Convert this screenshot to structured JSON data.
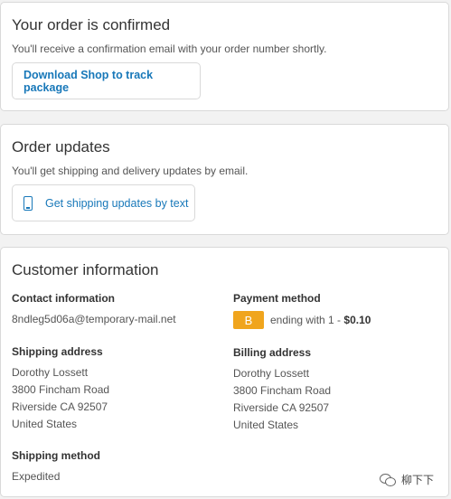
{
  "confirmation": {
    "title": "Your order is confirmed",
    "subtitle": "You'll receive a confirmation email with your order number shortly.",
    "button_label": "Download Shop to track package"
  },
  "updates": {
    "title": "Order updates",
    "subtitle": "You'll get shipping and delivery updates by email.",
    "button_label": "Get shipping updates by text",
    "button_icon": "phone-icon"
  },
  "customer": {
    "title": "Customer information",
    "contact_label": "Contact information",
    "contact_email": "8ndleg5d06a@temporary-mail.net",
    "payment_label": "Payment method",
    "payment_badge": "B",
    "payment_text": "ending with 1 - ",
    "payment_amount": "$0.10",
    "shipping_address_label": "Shipping address",
    "shipping_address": [
      "Dorothy Lossett",
      "3800 Fincham Road",
      "Riverside CA 92507",
      "United States"
    ],
    "billing_address_label": "Billing address",
    "billing_address": [
      "Dorothy Lossett",
      "3800 Fincham Road",
      "Riverside CA 92507",
      "United States"
    ],
    "shipping_method_label": "Shipping method",
    "shipping_method": "Expedited"
  },
  "watermark": {
    "text": "柳下下",
    "icon": "wechat-icon"
  },
  "colors": {
    "link": "#1878b9",
    "badge": "#f0a51d"
  }
}
